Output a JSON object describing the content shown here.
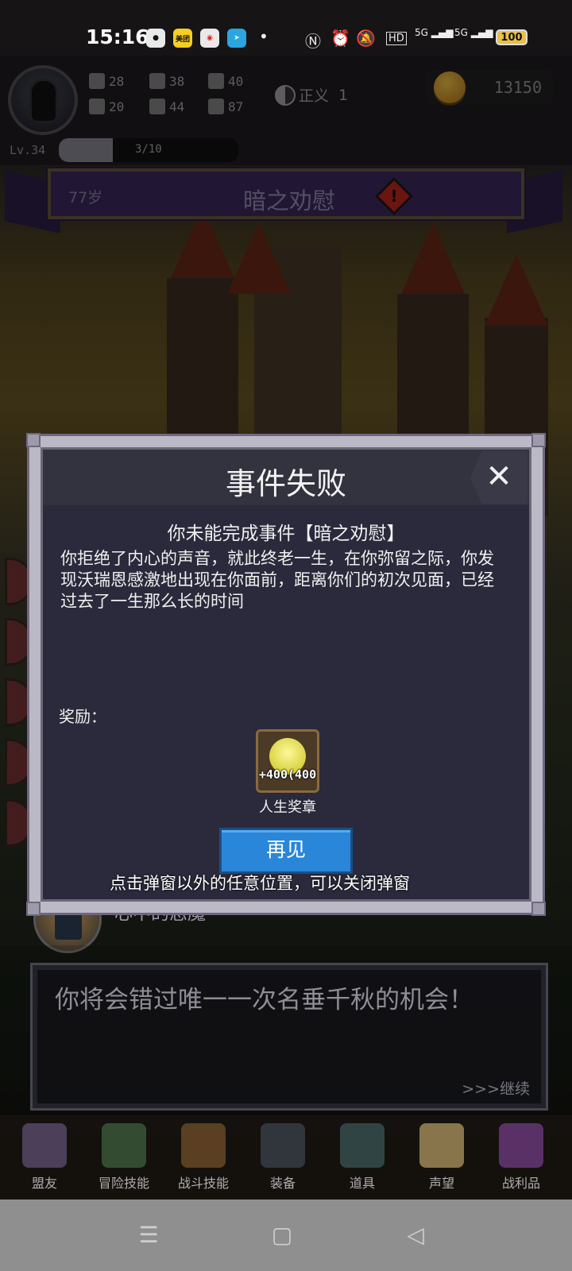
{
  "status_bar": {
    "time": "15:16",
    "apps": [
      "wechat-icon",
      "meituan-icon",
      "red-app-icon",
      "telegram-icon"
    ],
    "meituan_label": "美团",
    "network_1": "5G",
    "network_2": "5G",
    "battery": "100"
  },
  "player": {
    "level": "Lv.34",
    "xp_text": "3/10",
    "xp_fraction": 0.3,
    "stats": {
      "strength": "28",
      "agility": "38",
      "magic": "40",
      "luck": "20",
      "defense": "44",
      "charm": "87"
    },
    "alignment_label": "正义",
    "alignment_value": "1",
    "gold": "13150"
  },
  "banner": {
    "age": "77岁",
    "event_title": "暗之劝慰"
  },
  "modal": {
    "title": "事件失败",
    "subtitle": "你未能完成事件【暗之劝慰】",
    "body": "你拒绝了内心的声音，就此终老一生，在你弥留之际，你发现沃瑞恩感激地出现在你面前，距离你们的初次见面，已经过去了一生那么长的时间",
    "reward_label": "奖励：",
    "reward_amount": "+400(400",
    "reward_name": "人生奖章",
    "button_label": "再见",
    "close_symbol": "✕"
  },
  "dismiss_hint": "点击弹窗以外的任意位置，可以关闭弹窗",
  "npc": {
    "name": "心中的恶魔"
  },
  "dialog": {
    "text": "你将会错过唯一一次名垂千秋的机会！",
    "continue_label": ">>>继续"
  },
  "bottom_nav": [
    {
      "label": "盟友",
      "icon": "ally-icon"
    },
    {
      "label": "冒险技能",
      "icon": "adventure-skill-book-icon"
    },
    {
      "label": "战斗技能",
      "icon": "combat-skill-backpack-icon"
    },
    {
      "label": "装备",
      "icon": "equipment-swords-icon"
    },
    {
      "label": "道具",
      "icon": "item-bag-icon"
    },
    {
      "label": "声望",
      "icon": "reputation-scroll-icon"
    },
    {
      "label": "战利品",
      "icon": "loot-chest-icon"
    }
  ],
  "colors": {
    "banner_purple": "#3c2a62",
    "modal_bg": "#2b2a3c",
    "button_blue": "#2a86d9",
    "warning_red": "#c2271e"
  }
}
